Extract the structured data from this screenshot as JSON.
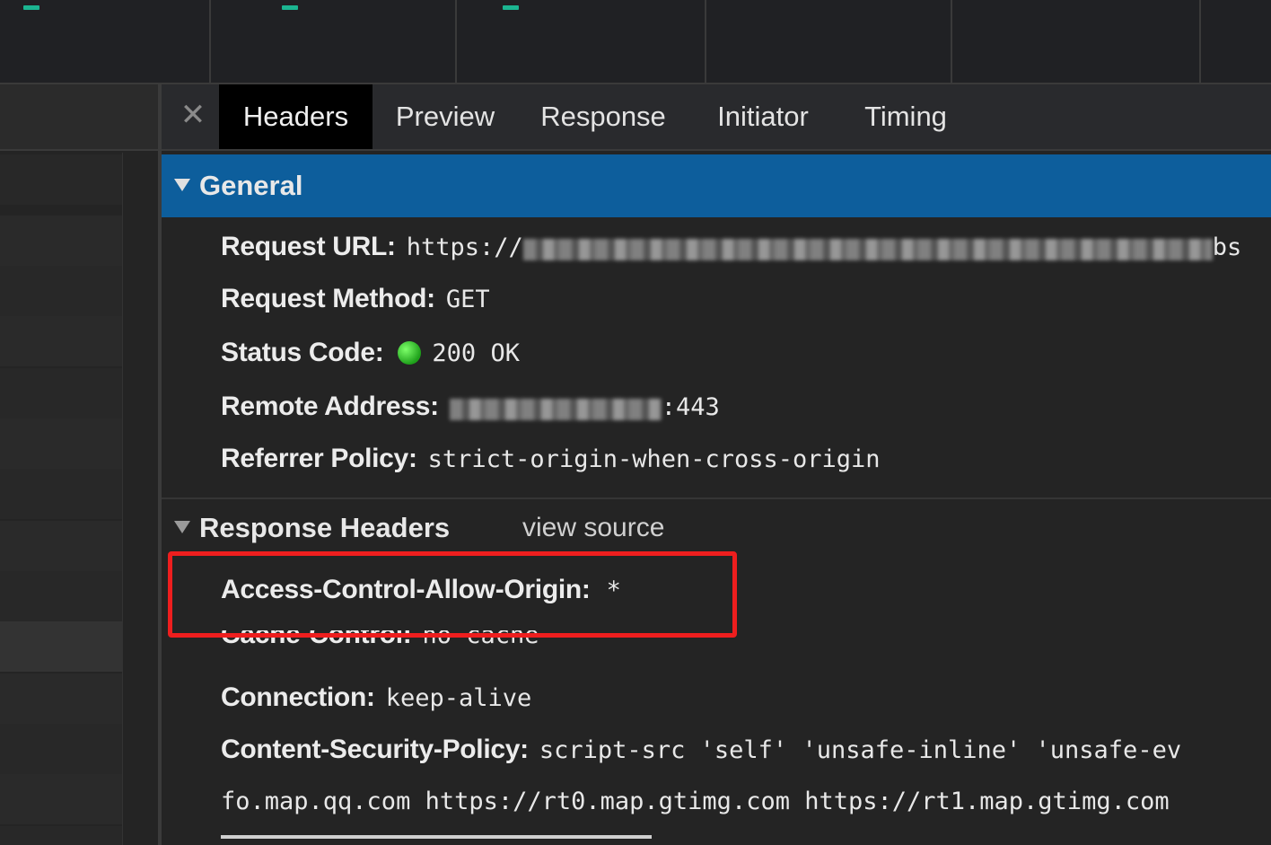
{
  "tabs": [
    {
      "label": "Headers",
      "active": true
    },
    {
      "label": "Preview",
      "active": false
    },
    {
      "label": "Response",
      "active": false
    },
    {
      "label": "Initiator",
      "active": false
    },
    {
      "label": "Timing",
      "active": false
    }
  ],
  "close_glyph": "✕",
  "general": {
    "title": "General",
    "request_url_key": "Request URL:",
    "request_url_value": "https://",
    "request_url_tail": "bs",
    "request_method_key": "Request Method:",
    "request_method_value": "GET",
    "status_code_key": "Status Code:",
    "status_code_value": "200 OK",
    "remote_address_key": "Remote Address:",
    "remote_address_value": ":443",
    "referrer_policy_key": "Referrer Policy:",
    "referrer_policy_value": "strict-origin-when-cross-origin"
  },
  "response_headers": {
    "title": "Response Headers",
    "view_source": "view source",
    "items": [
      {
        "key": "Access-Control-Allow-Origin:",
        "value": "*"
      },
      {
        "key": "Cache-Control:",
        "value": "no-cache"
      },
      {
        "key": "Connection:",
        "value": "keep-alive"
      },
      {
        "key": "Content-Security-Policy:",
        "value": "script-src 'self' 'unsafe-inline' 'unsafe-ev"
      }
    ],
    "csp_continuation": "fo.map.qq.com https://rt0.map.gtimg.com https://rt1.map.gtimg.com"
  },
  "colors": {
    "general_header_bg": "#0d5e9c",
    "highlight_border": "#ee1e1e",
    "status_ok": "#1ea01a",
    "timeline_mark": "#1bb591"
  }
}
